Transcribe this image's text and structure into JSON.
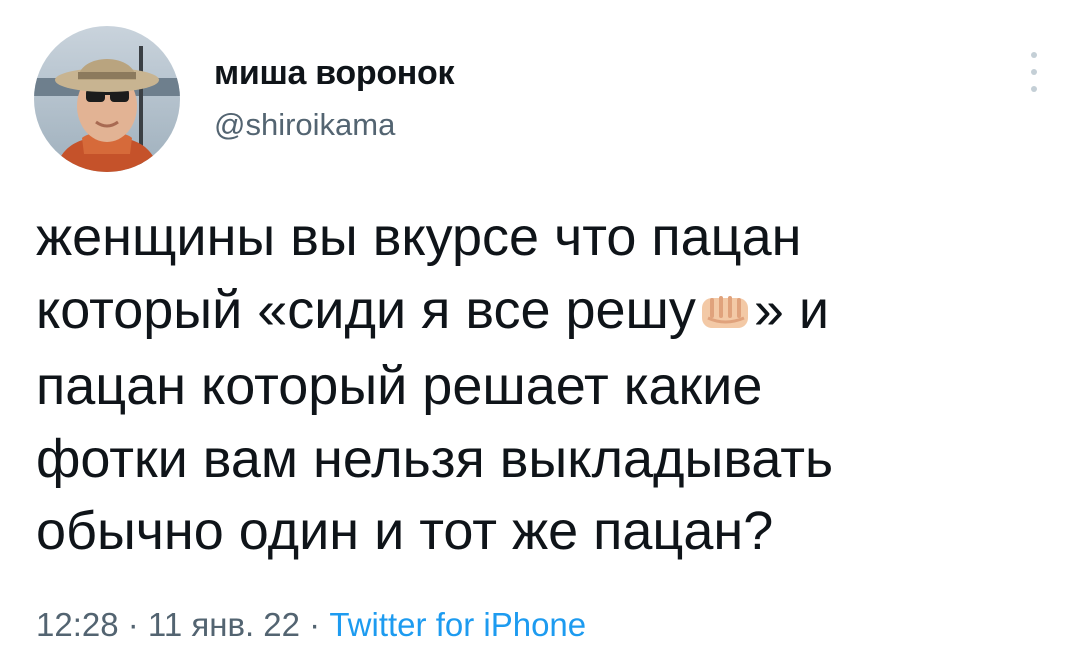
{
  "author": {
    "display_name": "миша воронок",
    "handle": "@shiroikama",
    "avatar_icon": "profile-photo-avatar"
  },
  "menu": {
    "icon": "more-vertical-icon"
  },
  "tweet": {
    "line1": "женщины вы вкурсе что пацан",
    "line2_before": "который «сиди я все решу",
    "line2_emoji": "fist-emoji",
    "line2_after": "» и",
    "line3": "пацан который решает какие",
    "line4": "фотки вам нельзя выкладывать",
    "line5": "обычно один и тот же пацан?"
  },
  "meta": {
    "time": "12:28",
    "sep1": " · ",
    "date": "11 янв. 22",
    "sep2": " · ",
    "source": "Twitter for iPhone"
  },
  "colors": {
    "text": "#0f1419",
    "secondary": "#536471",
    "link": "#1d9bf0"
  }
}
